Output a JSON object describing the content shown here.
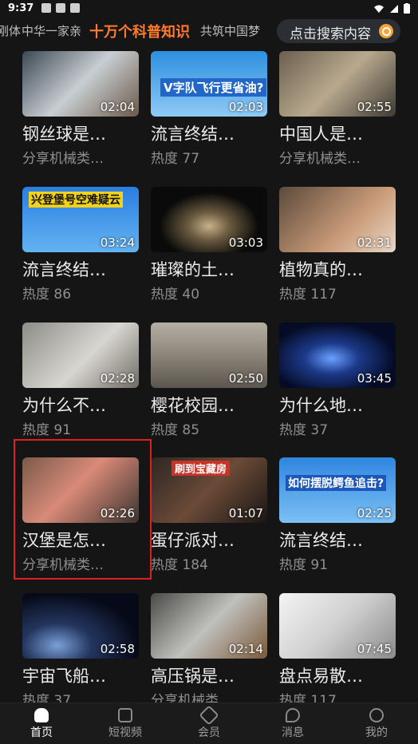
{
  "status_bar": {
    "time": "9:37"
  },
  "top_nav": {
    "tabs": [
      "刚体",
      "中华一家亲",
      "十万个科普知识",
      "共筑中国梦"
    ],
    "active_tab": "十万个科普知识",
    "search_placeholder": "点击搜索内容"
  },
  "colors": {
    "accent": "#ff7b2e",
    "background": "#151515",
    "highlight_box": "#e11f1f"
  },
  "videos": [
    {
      "title": "钢丝球是…",
      "meta": "分享机械类…",
      "duration": "02:04"
    },
    {
      "title": "流言终结…",
      "meta": "热度 77",
      "duration": "02:03",
      "caption": "V字队飞行更省油?"
    },
    {
      "title": "中国人是…",
      "meta": "分享机械类…",
      "duration": "02:55"
    },
    {
      "title": "流言终结…",
      "meta": "热度 86",
      "duration": "03:24",
      "caption": "兴登堡号空难疑云"
    },
    {
      "title": "璀璨的土…",
      "meta": "热度 40",
      "duration": "03:03"
    },
    {
      "title": "植物真的…",
      "meta": "热度 117",
      "duration": "02:31"
    },
    {
      "title": "为什么不…",
      "meta": "热度 91",
      "duration": "02:28"
    },
    {
      "title": "樱花校园…",
      "meta": "热度 85",
      "duration": "02:50"
    },
    {
      "title": "为什么地…",
      "meta": "热度 37",
      "duration": "03:45"
    },
    {
      "title": "汉堡是怎…",
      "meta": "分享机械类…",
      "duration": "02:26"
    },
    {
      "title": "蛋仔派对…",
      "meta": "热度 184",
      "duration": "01:07",
      "caption": "刷到宝藏房"
    },
    {
      "title": "流言终结…",
      "meta": "热度 91",
      "duration": "02:25",
      "caption": "如何摆脱鳄鱼追击?"
    },
    {
      "title": "宇宙飞船…",
      "meta": "热度 37",
      "duration": "02:58"
    },
    {
      "title": "高压锅是…",
      "meta": "分享机械类…",
      "duration": "02:14"
    },
    {
      "title": "盘点易散…",
      "meta": "热度 117",
      "duration": "07:45"
    }
  ],
  "bottom_nav": [
    {
      "label": "首页",
      "icon": "home-icon",
      "active": true
    },
    {
      "label": "短视频",
      "icon": "play-icon",
      "active": false
    },
    {
      "label": "会员",
      "icon": "diamond-icon",
      "active": false
    },
    {
      "label": "消息",
      "icon": "message-icon",
      "active": false
    },
    {
      "label": "我的",
      "icon": "profile-icon",
      "active": false
    }
  ]
}
